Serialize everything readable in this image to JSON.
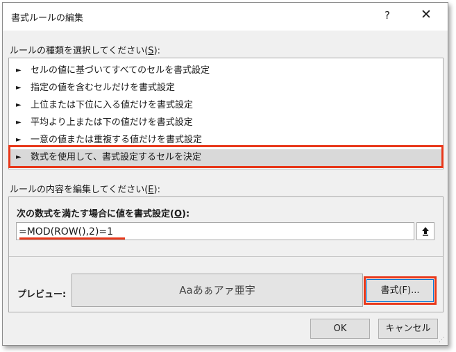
{
  "dialog": {
    "title": "書式ルールの編集",
    "help_label": "?",
    "close_label": "✕"
  },
  "rule_type": {
    "label_prefix": "ルールの種類を選択してください(",
    "label_accel": "S",
    "label_suffix": "):",
    "items": [
      {
        "label": "セルの値に基づいてすべてのセルを書式設定"
      },
      {
        "label": "指定の値を含むセルだけを書式設定"
      },
      {
        "label": "上位または下位に入る値だけを書式設定"
      },
      {
        "label": "平均より上または下の値だけを書式設定"
      },
      {
        "label": "一意の値または重複する値だけを書式設定"
      },
      {
        "label": "数式を使用して、書式設定するセルを決定"
      }
    ],
    "selected_index": 5
  },
  "rule_edit": {
    "label_prefix": "ルールの内容を編集してください(",
    "label_accel": "E",
    "label_suffix": "):",
    "formula_label_prefix": "次の数式を満たす場合に値を書式設定(",
    "formula_label_accel": "O",
    "formula_label_suffix": "):",
    "formula_value": "=MOD(ROW(),2)=1",
    "collapse_icon": "arrow-up-icon",
    "preview_label": "プレビュー:",
    "preview_text": "Aaあぁアァ亜宇",
    "format_button_label": "書式(F)..."
  },
  "footer": {
    "ok_label": "OK",
    "cancel_label": "キャンセル"
  },
  "colors": {
    "highlight": "#e8381a",
    "dialog_bg": "#f0f0f0",
    "selection_bg": "#d9d9d9"
  }
}
